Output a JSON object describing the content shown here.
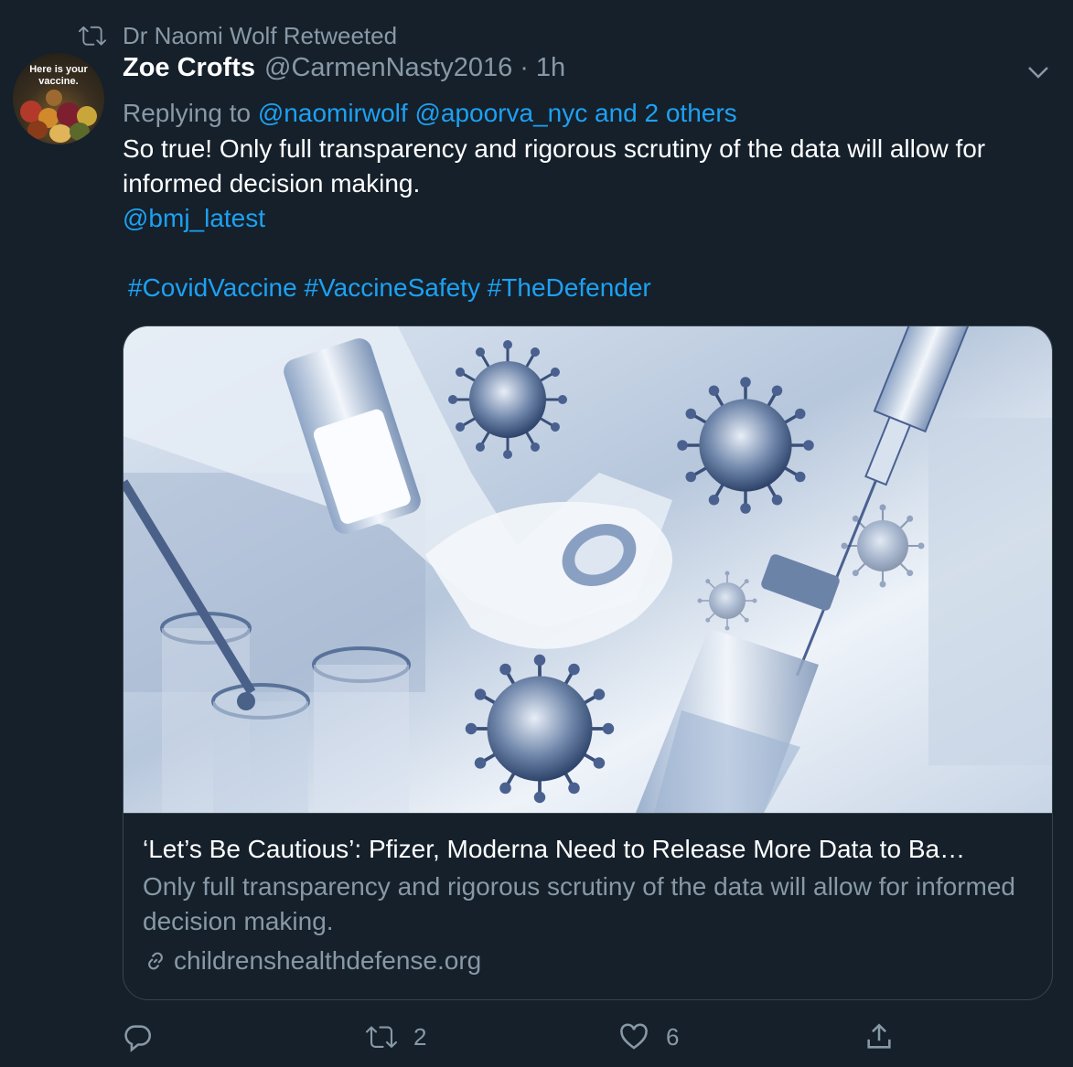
{
  "retweet_banner": {
    "text": "Dr Naomi Wolf Retweeted",
    "icon": "retweet-icon"
  },
  "author": {
    "display_name": "Zoe Crofts",
    "handle": "@CarmenNasty2016",
    "separator": "·",
    "time": "1h",
    "avatar_text": "Here is your vaccine."
  },
  "reply_context": {
    "prefix": "Replying to",
    "mentions": "@naomirwolf @apoorva_nyc and 2 others"
  },
  "tweet": {
    "text": "So true! Only full transparency and rigorous scrutiny of the data will allow for informed decision making.",
    "mention": "@bmj_latest",
    "hashtags": "#CovidVaccine #VaccineSafety #TheDefender"
  },
  "card": {
    "title": "‘Let’s Be Cautious’: Pfizer, Moderna Need to Release More Data to Ba…",
    "description": "Only full transparency and rigorous scrutiny of the data will allow for informed decision making.",
    "domain": "childrenshealthdefense.org"
  },
  "actions": {
    "reply_count": "",
    "retweet_count": "2",
    "like_count": "6"
  },
  "colors": {
    "background": "#15202b",
    "link": "#1da1f2",
    "secondary_text": "#8899a6",
    "border": "#38444d"
  }
}
